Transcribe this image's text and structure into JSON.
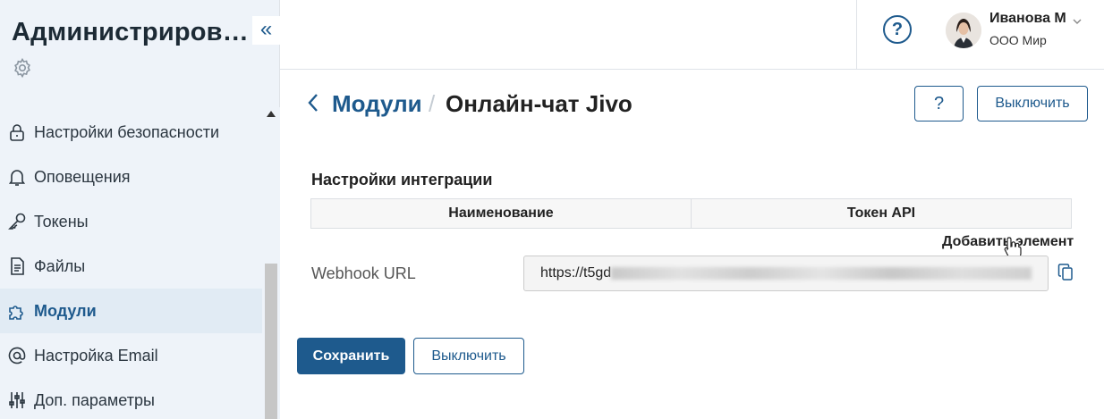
{
  "sidebar": {
    "title": "Администриров…",
    "collapse_glyph": "«",
    "items": [
      {
        "label": "Настройки безопасности",
        "icon": "lock-icon"
      },
      {
        "label": "Оповещения",
        "icon": "bell-icon"
      },
      {
        "label": "Токены",
        "icon": "key-icon"
      },
      {
        "label": "Файлы",
        "icon": "file-icon"
      },
      {
        "label": "Модули",
        "icon": "puzzle-icon",
        "active": true
      },
      {
        "label": "Настройка Email",
        "icon": "at-icon"
      },
      {
        "label": "Доп. параметры",
        "icon": "sliders-icon"
      }
    ]
  },
  "header": {
    "help_glyph": "?",
    "user": {
      "name": "Иванова М",
      "org": "ООО Мир"
    }
  },
  "main": {
    "breadcrumb": {
      "parent": "Модули",
      "separator": "/",
      "current": "Онлайн-чат Jivo"
    },
    "actions": {
      "help_glyph": "?",
      "disable_label": "Выключить"
    },
    "section_title": "Настройки интеграции",
    "table": {
      "columns": [
        "Наименование",
        "Токен API"
      ]
    },
    "tooltip": "Добавить элемент",
    "webhook": {
      "label": "Webhook URL",
      "value": "https://t5gd"
    },
    "buttons": {
      "save": "Сохранить",
      "disable": "Выключить"
    }
  },
  "colors": {
    "accent": "#1e5a8d",
    "sidebar_bg": "#eef3f9",
    "active_bg": "#e1ebf4"
  }
}
